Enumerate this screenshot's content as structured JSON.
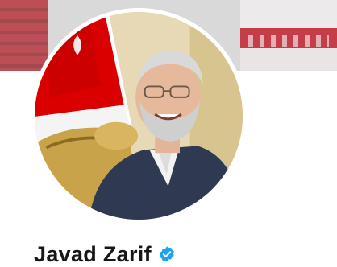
{
  "profile": {
    "display_name": "Javad Zarif",
    "verified": true
  },
  "icons": {
    "verified_badge": "verified-badge-icon",
    "verified_color": "#1da1f2"
  },
  "colors": {
    "flag_red": "#da0000",
    "flag_white": "#ffffff",
    "flag_green": "#239f40",
    "suit": "#2f3a52"
  }
}
